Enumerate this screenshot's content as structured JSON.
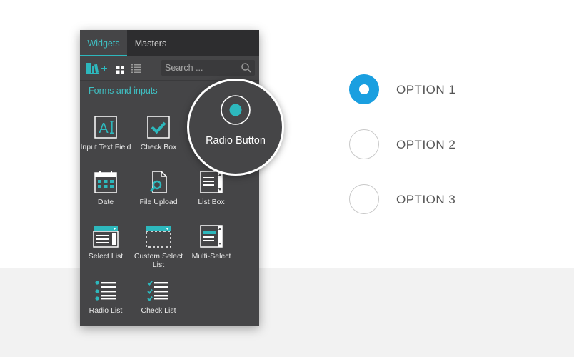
{
  "panel": {
    "tabs": [
      {
        "label": "Widgets",
        "active": true
      },
      {
        "label": "Masters",
        "active": false
      }
    ],
    "search": {
      "placeholder": "Search ..."
    },
    "section_title": "Forms and inputs",
    "widgets": [
      {
        "label": "Input Text Field",
        "icon": "input-text-field-icon"
      },
      {
        "label": "Check Box",
        "icon": "check-box-icon"
      },
      {
        "label": "Date",
        "icon": "date-icon"
      },
      {
        "label": "File Upload",
        "icon": "file-upload-icon"
      },
      {
        "label": "List Box",
        "icon": "list-box-icon"
      },
      {
        "label": "Select List",
        "icon": "select-list-icon"
      },
      {
        "label": "Custom Select List",
        "icon": "custom-select-list-icon"
      },
      {
        "label": "Multi-Select",
        "icon": "multi-select-icon"
      },
      {
        "label": "Radio List",
        "icon": "radio-list-icon"
      },
      {
        "label": "Check List",
        "icon": "check-list-icon"
      }
    ],
    "magnified_widget": {
      "label": "Radio Button",
      "icon": "radio-button-icon"
    }
  },
  "options": [
    {
      "label": "OPTION 1",
      "checked": true
    },
    {
      "label": "OPTION 2",
      "checked": false
    },
    {
      "label": "OPTION 3",
      "checked": false
    }
  ],
  "colors": {
    "panel_bg": "#454547",
    "tabbar_bg": "#2d2d2f",
    "accent_teal": "#2db8bd",
    "radio_selected": "#1a9fe0",
    "option_text": "#555555"
  }
}
